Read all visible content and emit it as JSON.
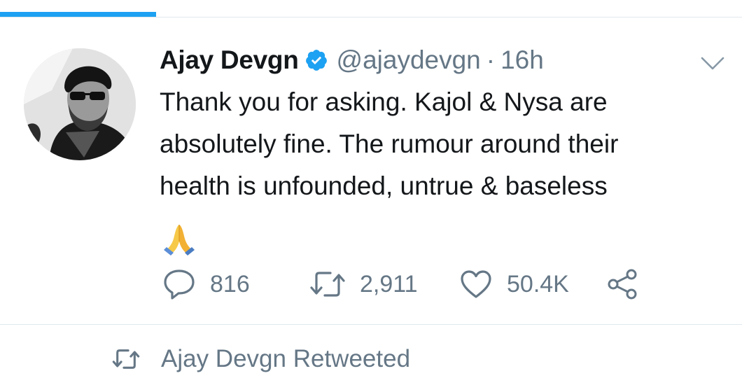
{
  "tweet": {
    "author": {
      "display_name": "Ajay Devgn",
      "handle": "@ajaydevgn",
      "verified": true
    },
    "separator": "·",
    "time": "16h",
    "text_lines": [
      "Thank you for asking. Kajol & Nysa are",
      "absolutely fine. The rumour around their",
      "health is unfounded, untrue & baseless"
    ],
    "emoji": "folded-hands",
    "actions": {
      "replies": "816",
      "retweets": "2,911",
      "likes": "50.4K"
    }
  },
  "context": {
    "label": "Ajay Devgn Retweeted",
    "icon": "retweet-icon"
  },
  "colors": {
    "accent": "#1da1f2",
    "secondary_text": "#657786",
    "divider": "#e1e8ed",
    "verified": "#1da1f2"
  }
}
